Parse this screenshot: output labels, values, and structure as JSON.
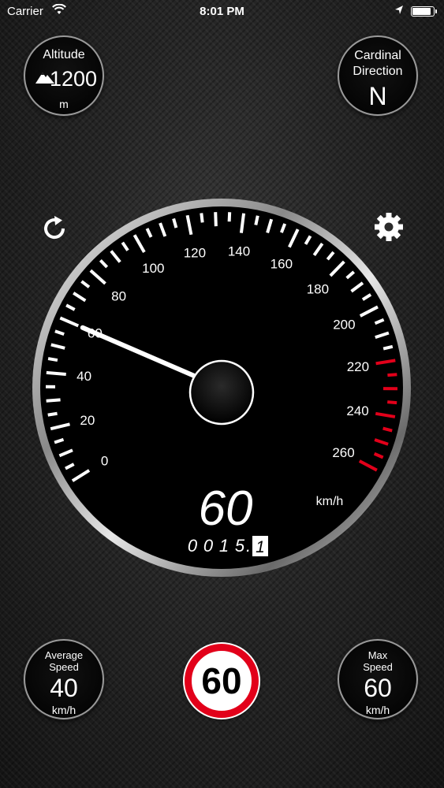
{
  "status_bar": {
    "carrier": "Carrier",
    "time": "8:01 PM",
    "battery_level": 0.9
  },
  "altitude": {
    "label": "Altitude",
    "value": "1200",
    "unit": "m",
    "icon": "mountain-icon"
  },
  "cardinal": {
    "label_line1": "Cardinal",
    "label_line2": "Direction",
    "value": "N"
  },
  "controls": {
    "reset_icon": "refresh-icon",
    "settings_icon": "gear-icon"
  },
  "speedometer": {
    "min": 0,
    "max": 260,
    "major_step": 20,
    "tick_labels": [
      "0",
      "20",
      "40",
      "60",
      "80",
      "100",
      "120",
      "140",
      "160",
      "180",
      "200",
      "220",
      "240",
      "260"
    ],
    "red_zone_from": 220,
    "current_speed": 60,
    "speed_display": "60",
    "unit": "km/h",
    "odometer_digits": [
      "0",
      "0",
      "1",
      "5"
    ],
    "odometer_decimal": "1",
    "accent_red": "#e2001a"
  },
  "average_speed": {
    "label_line1": "Average",
    "label_line2": "Speed",
    "value": "40",
    "unit": "km/h"
  },
  "speed_limit": {
    "value": "60"
  },
  "max_speed": {
    "label_line1": "Max",
    "label_line2": "Speed",
    "value": "60",
    "unit": "km/h"
  }
}
